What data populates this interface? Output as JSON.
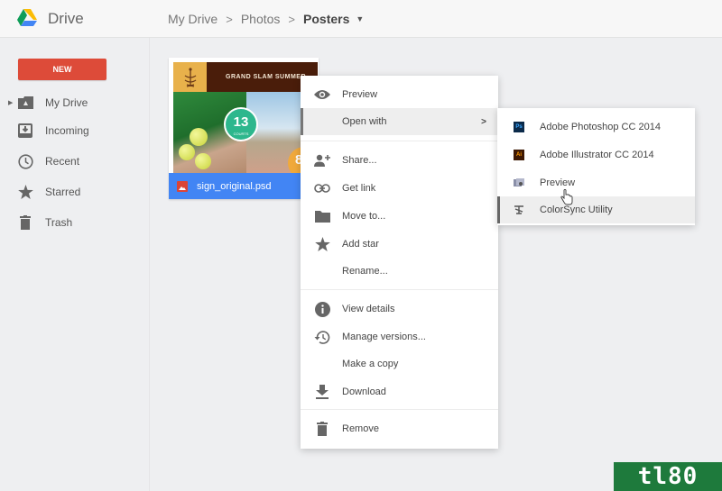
{
  "app": {
    "title": "Drive",
    "logo_icon": "google-drive-logo"
  },
  "breadcrumb": {
    "items": [
      "My Drive",
      "Photos",
      "Posters"
    ],
    "separator": ">",
    "dropdown_icon": "caret-down-icon"
  },
  "sidebar": {
    "new_button": "NEW",
    "new_button_color": "#dd4b39",
    "items": [
      {
        "label": "My Drive",
        "icon": "drive-folder-icon",
        "expandable": true
      },
      {
        "label": "Incoming",
        "icon": "incoming-icon"
      },
      {
        "label": "Recent",
        "icon": "clock-icon"
      },
      {
        "label": "Starred",
        "icon": "star-icon"
      },
      {
        "label": "Trash",
        "icon": "trash-icon"
      }
    ]
  },
  "file": {
    "name": "sign_original.psd",
    "thumbnail": {
      "banner_text": "GRAND SLAM SUMMER",
      "badge_primary_number": "13",
      "badge_primary_sub": "COURTS",
      "badge_secondary_number": "8"
    },
    "selected_color": "#4285f4"
  },
  "context_menu": {
    "items": [
      {
        "label": "Preview",
        "icon": "eye-icon"
      },
      {
        "label": "Open with",
        "icon": "",
        "has_submenu": true,
        "active": true
      },
      {
        "label": "Share...",
        "icon": "person-add-icon"
      },
      {
        "label": "Get link",
        "icon": "link-icon"
      },
      {
        "label": "Move to...",
        "icon": "folder-icon"
      },
      {
        "label": "Add star",
        "icon": "star-icon"
      },
      {
        "label": "Rename...",
        "icon": ""
      },
      {
        "label": "View details",
        "icon": "info-icon"
      },
      {
        "label": "Manage versions...",
        "icon": "history-icon"
      },
      {
        "label": "Make a copy",
        "icon": ""
      },
      {
        "label": "Download",
        "icon": "download-icon"
      },
      {
        "label": "Remove",
        "icon": "trash-icon"
      }
    ],
    "submenu_chevron": ">"
  },
  "open_with_submenu": {
    "items": [
      {
        "label": "Adobe Photoshop CC 2014",
        "icon": "photoshop-icon",
        "icon_text": "Ps"
      },
      {
        "label": "Adobe Illustrator CC 2014",
        "icon": "illustrator-icon",
        "icon_text": "Ai"
      },
      {
        "label": "Preview",
        "icon": "preview-app-icon"
      },
      {
        "label": "ColorSync Utility",
        "icon": "colorsync-icon",
        "active": true
      }
    ]
  },
  "watermark": {
    "text": "tl80"
  }
}
